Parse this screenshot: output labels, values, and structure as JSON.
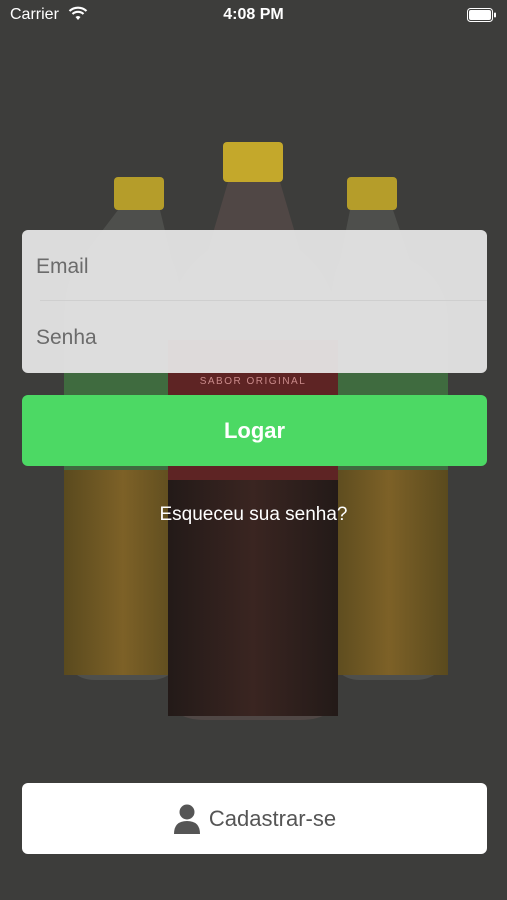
{
  "status_bar": {
    "carrier": "Carrier",
    "time": "4:08 PM"
  },
  "login": {
    "email_placeholder": "Email",
    "password_placeholder": "Senha",
    "login_label": "Logar",
    "forgot_label": "Esqueceu sua senha?"
  },
  "signup": {
    "label": "Cadastrar-se",
    "icon": "user-icon"
  },
  "background": {
    "image": "soda-bottles",
    "bottle_label": "SABOR ORIGINAL"
  },
  "colors": {
    "background": "#3d3d3b",
    "login_button": "#4cd964",
    "signup_button": "#ffffff",
    "card": "#e8e8e8"
  }
}
